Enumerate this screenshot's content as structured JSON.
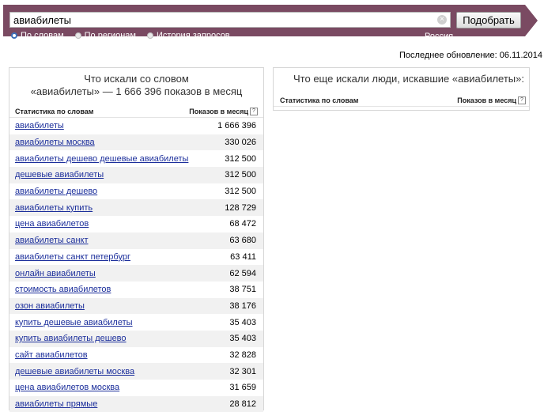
{
  "search": {
    "query": "авиабилеты",
    "submit_label": "Подобрать",
    "clear_symbol": "×",
    "modes": [
      {
        "label": "По словам",
        "selected": true
      },
      {
        "label": "По регионам",
        "selected": false
      },
      {
        "label": "История запросов",
        "selected": false
      }
    ],
    "region": "Россия"
  },
  "last_update": "Последнее обновление: 06.11.2014",
  "left_panel": {
    "title_line1": "Что искали со словом",
    "title_line2": "«авиабилеты» — 1 666 396 показов в месяц",
    "col_phrase": "Статистика по словам",
    "col_count": "Показов в месяц",
    "help": "?",
    "rows": [
      {
        "phrase": "авиабилеты",
        "count": "1 666 396"
      },
      {
        "phrase": "авиабилеты москва",
        "count": "330 026"
      },
      {
        "phrase": "авиабилеты дешево дешевые авиабилеты",
        "count": "312 500"
      },
      {
        "phrase": "дешевые авиабилеты",
        "count": "312 500"
      },
      {
        "phrase": "авиабилеты дешево",
        "count": "312 500"
      },
      {
        "phrase": "авиабилеты купить",
        "count": "128 729"
      },
      {
        "phrase": "цена авиабилетов",
        "count": "68 472"
      },
      {
        "phrase": "авиабилеты санкт",
        "count": "63 680"
      },
      {
        "phrase": "авиабилеты санкт петербург",
        "count": "63 411"
      },
      {
        "phrase": "онлайн авиабилеты",
        "count": "62 594"
      },
      {
        "phrase": "стоимость авиабилетов",
        "count": "38 751"
      },
      {
        "phrase": "озон авиабилеты",
        "count": "38 176"
      },
      {
        "phrase": "купить дешевые авиабилеты",
        "count": "35 403"
      },
      {
        "phrase": "купить авиабилеты дешево",
        "count": "35 403"
      },
      {
        "phrase": "сайт авиабилетов",
        "count": "32 828"
      },
      {
        "phrase": "дешевые авиабилеты москва",
        "count": "32 301"
      },
      {
        "phrase": "цена авиабилетов москва",
        "count": "31 659"
      },
      {
        "phrase": "авиабилеты прямые",
        "count": "28 812"
      }
    ]
  },
  "right_panel": {
    "title": "Что еще искали люди, искавшие «авиабилеты»:",
    "col_phrase": "Статистика по словам",
    "col_count": "Показов в месяц",
    "help": "?"
  },
  "colors": {
    "topbar": "#7a4a62",
    "link": "#1b2e9b",
    "row_alt": "#f1f1f1"
  }
}
